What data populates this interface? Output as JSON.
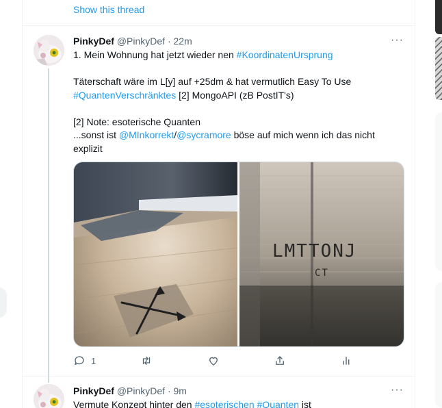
{
  "show_thread": "Show this thread",
  "tweets": [
    {
      "name": "PinkyDef",
      "handle": "@PinkyDef",
      "dot": "·",
      "time": "22m",
      "more": "···",
      "lines": [
        [
          {
            "t": "1. Mein Wohnung hat jetzt wieder nen "
          },
          {
            "t": "#KoordinatenUrsprung",
            "link": true
          }
        ],
        [],
        [
          {
            "t": "Täterschaft wäre im L[y] auf +25dm & hat vermutlich Easy To Use"
          }
        ],
        [
          {
            "t": "#QuantenVerschränktes",
            "link": true
          },
          {
            "t": " [2] MongoAPI (zB PostIT's)"
          }
        ],
        [],
        [
          {
            "t": "[2] Note: esoterische Quanten"
          }
        ],
        [
          {
            "t": "...sonst ist "
          },
          {
            "t": "@MInkorrekt",
            "link": true
          },
          {
            "t": "/"
          },
          {
            "t": "@sycramore",
            "link": true
          },
          {
            "t": " böse auf mich wenn ich das nicht"
          }
        ],
        [
          {
            "t": "explizit"
          }
        ]
      ],
      "media": {
        "left_image": "floor-cross-photo",
        "right_image": "window-blind-photo",
        "right_text_line1": "LMTTONJ",
        "right_text_line2": "CT"
      },
      "actions": {
        "reply_count": "1",
        "retweet_count": "",
        "like_count": "",
        "icons": [
          "reply-icon",
          "retweet-icon",
          "like-icon",
          "share-icon",
          "analytics-icon"
        ]
      }
    },
    {
      "name": "PinkyDef",
      "handle": "@PinkyDef",
      "dot": "·",
      "time": "9m",
      "more": "···",
      "lines": [
        [
          {
            "t": "Vermute Konzept hinter den "
          },
          {
            "t": "#esoterischen",
            "link": true
          },
          {
            "t": " "
          },
          {
            "t": "#Quanten",
            "link": true
          },
          {
            "t": " ist"
          }
        ]
      ]
    }
  ],
  "colors": {
    "accent": "#1d9bf0",
    "text": "#0f1419",
    "muted": "#536471",
    "border": "#eff3f4"
  }
}
